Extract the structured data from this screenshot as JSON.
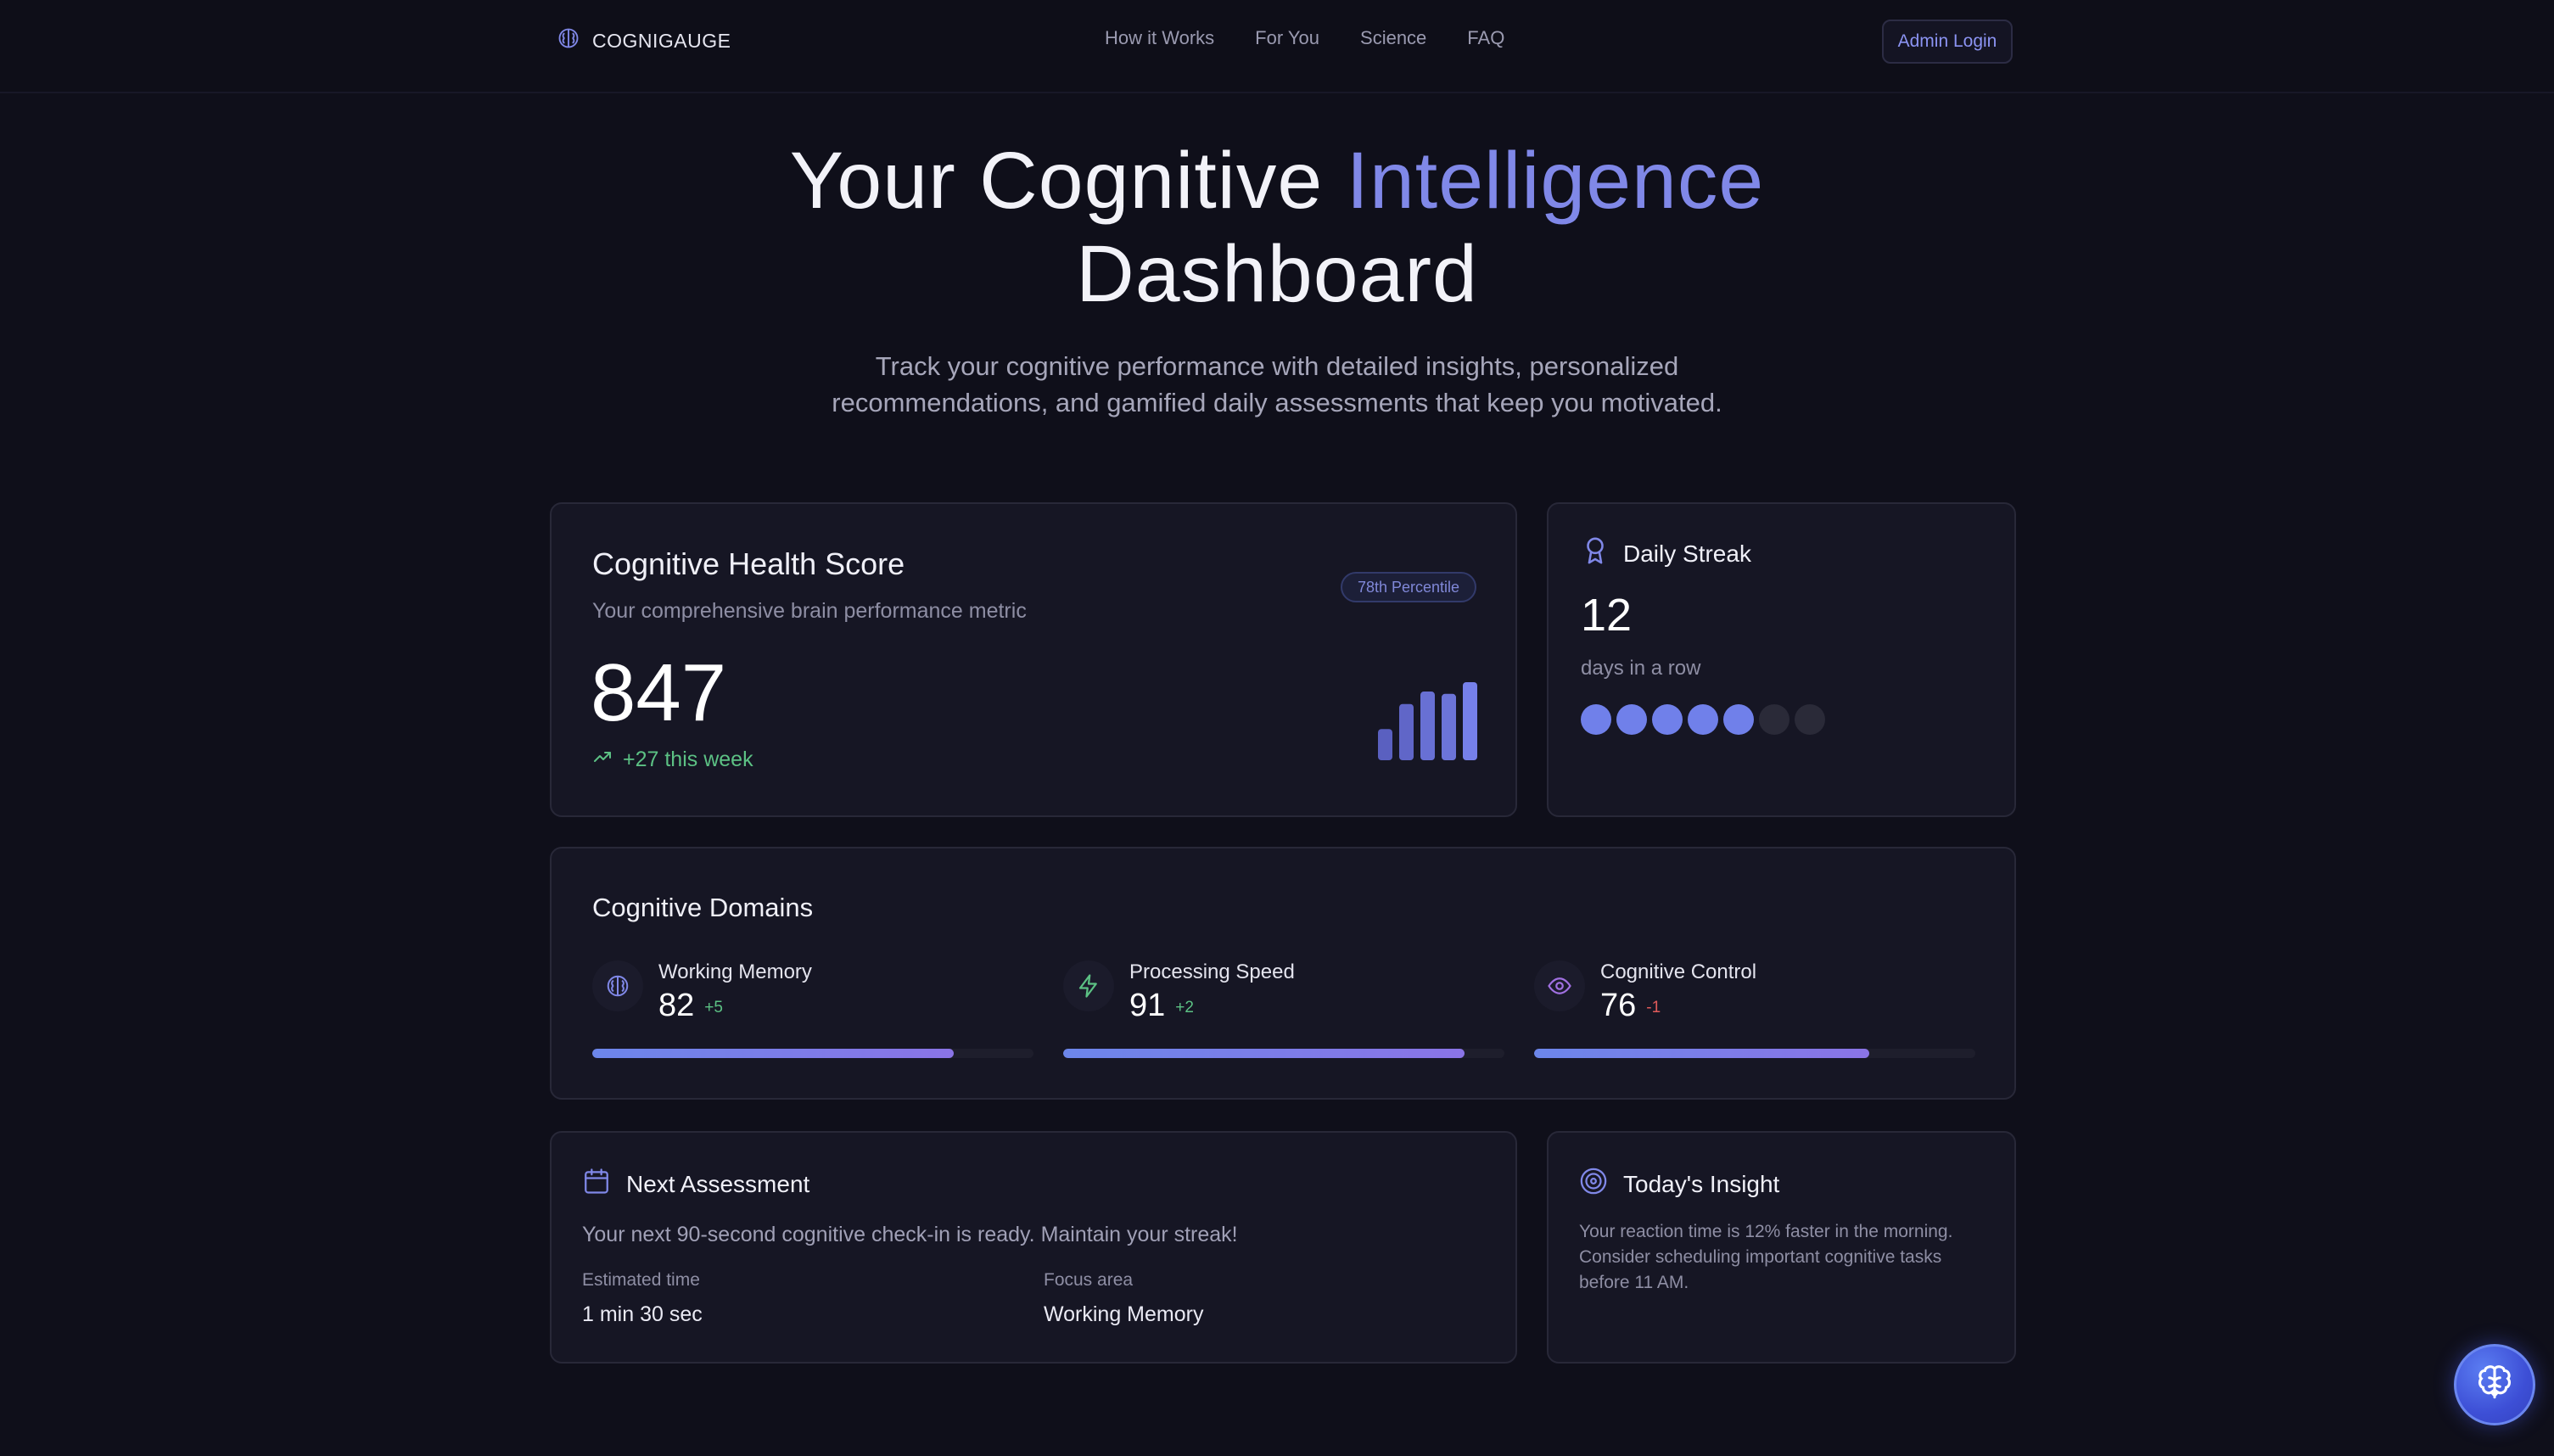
{
  "nav": {
    "brand": "COGNIGAUGE",
    "links": [
      "How it Works",
      "For You",
      "Science",
      "FAQ"
    ],
    "admin_label": "Admin Login"
  },
  "hero": {
    "title_part1": "Your Cognitive ",
    "title_accent": "Intelligence",
    "title_part2": "Dashboard",
    "subtitle": "Track your cognitive performance with detailed insights, personalized recommendations, and gamified daily assessments that keep you motivated."
  },
  "score": {
    "title": "Cognitive Health Score",
    "description": "Your comprehensive brain performance metric",
    "percentile": "78th Percentile",
    "value": "847",
    "trend": "+27 this week",
    "bar_levels": [
      0.4,
      0.72,
      0.88,
      0.85,
      1.0
    ]
  },
  "streak": {
    "title": "Daily Streak",
    "value": "12",
    "label": "days in a row",
    "days_filled": 5,
    "days_total": 7
  },
  "domains": {
    "title": "Cognitive Domains",
    "items": [
      {
        "name": "Working Memory",
        "value": "82",
        "delta": "+5",
        "direction": "up",
        "progress": 0.82,
        "icon": "brain-icon"
      },
      {
        "name": "Processing Speed",
        "value": "91",
        "delta": "+2",
        "direction": "up",
        "progress": 0.91,
        "icon": "lightning-icon"
      },
      {
        "name": "Cognitive Control",
        "value": "76",
        "delta": "-1",
        "direction": "down",
        "progress": 0.76,
        "icon": "eye-icon"
      }
    ]
  },
  "next_assessment": {
    "title": "Next Assessment",
    "description": "Your next 90-second cognitive check-in is ready. Maintain your streak!",
    "estimated_label": "Estimated time",
    "estimated_value": "1 min 30 sec",
    "focus_label": "Focus area",
    "focus_value": "Working Memory"
  },
  "insight": {
    "title": "Today's Insight",
    "text": "Your reaction time is 12% faster in the morning. Consider scheduling important cognitive tasks before 11 AM."
  },
  "colors": {
    "accent": "#8088e8",
    "positive": "#5cc184",
    "negative": "#e05a5a",
    "background": "#0f0f1a",
    "card": "#161624"
  }
}
